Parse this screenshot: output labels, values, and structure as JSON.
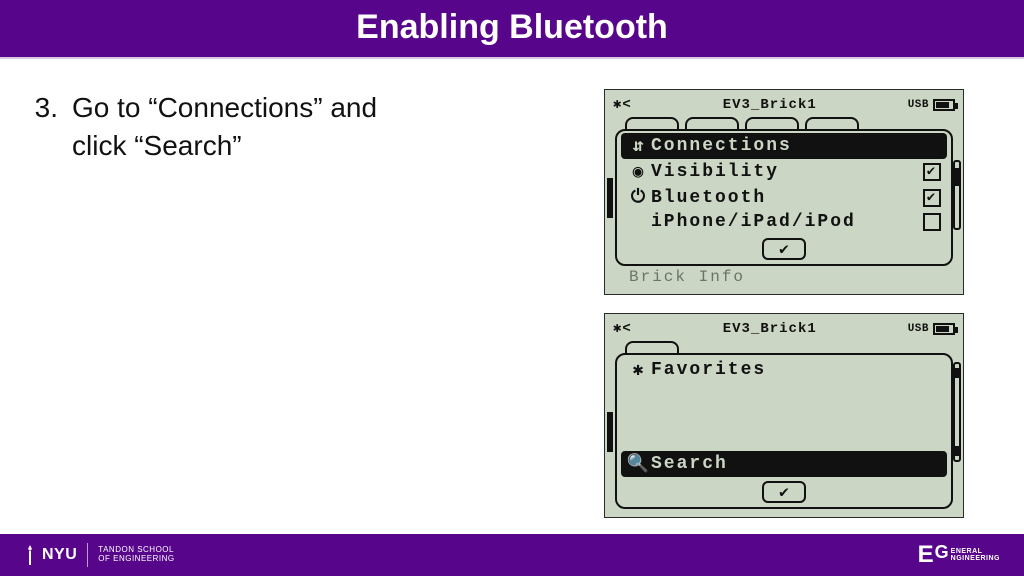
{
  "title": "Enabling Bluetooth",
  "step": {
    "num": "3.",
    "text": "Go to “Connections” and click “Search”"
  },
  "lcd1": {
    "device": "EV3_Brick1",
    "usb": "USB",
    "menu": {
      "connections": "Connections",
      "visibility": "Visibility",
      "bluetooth": "Bluetooth",
      "iphone": "iPhone/iPad/iPod"
    },
    "cutoff": "Brick Info"
  },
  "lcd2": {
    "device": "EV3_Brick1",
    "usb": "USB",
    "favorites": "Favorites",
    "search": "Search"
  },
  "footer": {
    "nyu": "NYU",
    "school1": "TANDON SCHOOL",
    "school2": "OF ENGINEERING",
    "eg_e": "E",
    "eg_g": "G",
    "eg1": "ENERAL",
    "eg2": "NGINEERING"
  }
}
